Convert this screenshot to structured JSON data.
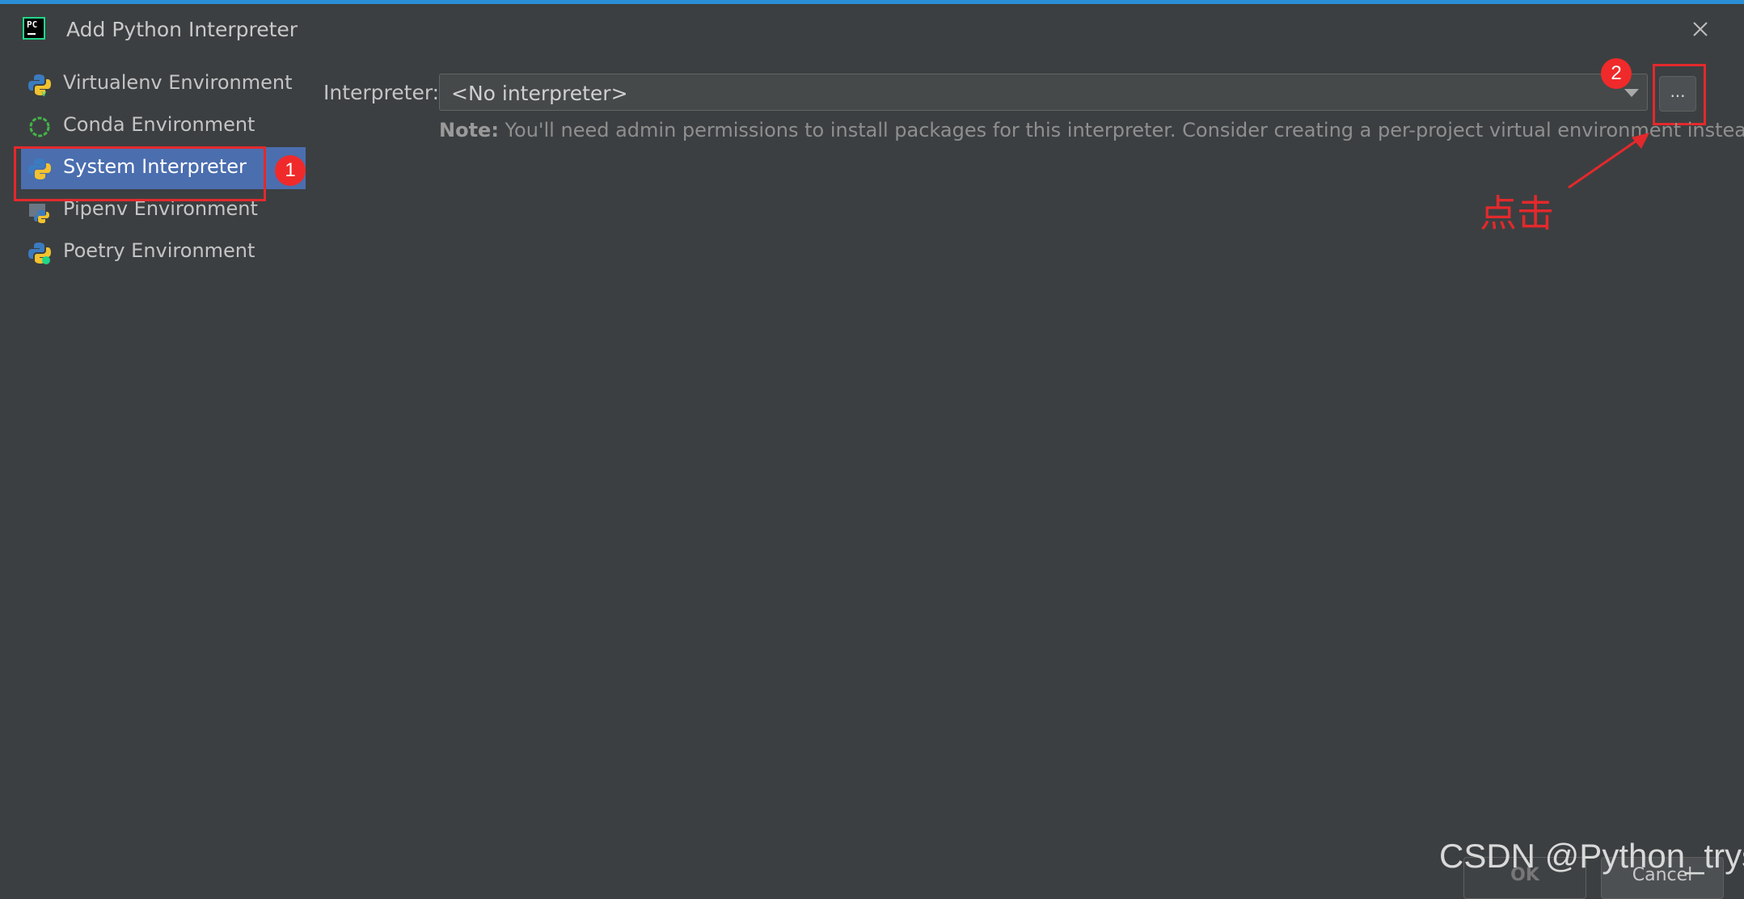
{
  "window": {
    "title": "Add Python Interpreter",
    "app_icon_text": "PC",
    "close_icon": "close-icon"
  },
  "sidebar": {
    "items": [
      {
        "label": "Virtualenv Environment",
        "icon": "virtualenv-python-icon"
      },
      {
        "label": "Conda Environment",
        "icon": "conda-ring-icon"
      },
      {
        "label": "System Interpreter",
        "icon": "python-icon",
        "selected": true
      },
      {
        "label": "Pipenv Environment",
        "icon": "pipenv-icon"
      },
      {
        "label": "Poetry Environment",
        "icon": "poetry-icon"
      }
    ]
  },
  "main": {
    "interpreter_label": "Interpreter:",
    "interpreter_value": "<No interpreter>",
    "browse_label": "...",
    "note_bold": "Note:",
    "note_text": " You'll need admin permissions to install packages for this interpreter. Consider creating a per-project virtual environment instead."
  },
  "annotations": {
    "badge_1": "1",
    "badge_2": "2",
    "click_text": "点击",
    "color": "#e3292c"
  },
  "footer": {
    "ok_label": "OK",
    "cancel_label": "Cancel"
  },
  "watermark": "CSDN @Python_trys",
  "colors": {
    "background": "#3c3f41",
    "selection": "#4b6eaf",
    "accent": "#2b8fd6"
  }
}
